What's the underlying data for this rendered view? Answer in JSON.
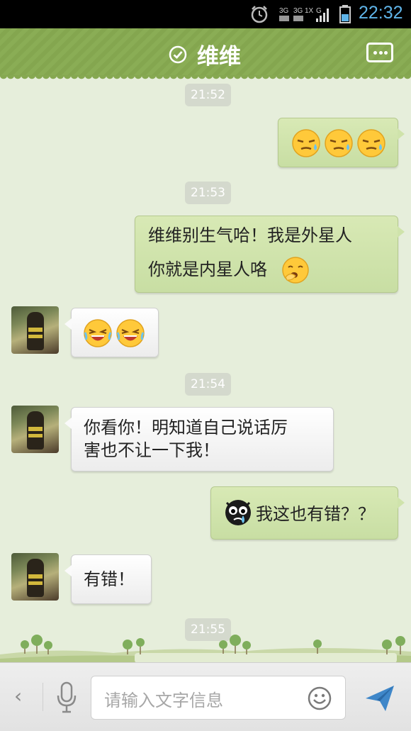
{
  "status_bar": {
    "time": "22:32",
    "network_icon": "signal-3g-1x-icon",
    "alarm_icon": "alarm-icon",
    "battery_icon": "battery-icon"
  },
  "header": {
    "title": "维维",
    "verified_icon": "check-circle-icon",
    "more_icon": "more-icon",
    "color": "#88aa53"
  },
  "messages": [
    {
      "type": "timestamp",
      "text": "21:52"
    },
    {
      "type": "outgoing",
      "emojis": [
        "sweat-face-emoji",
        "sweat-face-emoji",
        "sweat-face-emoji"
      ]
    },
    {
      "type": "timestamp",
      "text": "21:53"
    },
    {
      "type": "outgoing",
      "lines": [
        "维维别生气哈！我是外星人",
        "你就是内星人咯"
      ],
      "trailing_emoji": "yawn-emoji"
    },
    {
      "type": "incoming",
      "emojis": [
        "laugh-cry-emoji",
        "laugh-cry-emoji"
      ]
    },
    {
      "type": "timestamp",
      "text": "21:54"
    },
    {
      "type": "incoming",
      "lines": [
        "你看你！明知道自己说话厉",
        "害也不让一下我！"
      ]
    },
    {
      "type": "outgoing",
      "leading_emoji": "black-crying-emoji",
      "text": "我这也有错？？"
    },
    {
      "type": "incoming",
      "text": "有错！"
    },
    {
      "type": "timestamp",
      "text": "21:55"
    }
  ],
  "input_bar": {
    "back_label": "‹",
    "placeholder": "请输入文字信息",
    "mic_icon": "microphone-icon",
    "emoji_icon": "smiley-icon",
    "send_icon": "send-icon"
  },
  "colors": {
    "outgoing_bubble": "#cfe3ab",
    "incoming_bubble": "#f5f5f5",
    "chat_background": "#e6eedb",
    "time_text": "#5fb4e8"
  }
}
